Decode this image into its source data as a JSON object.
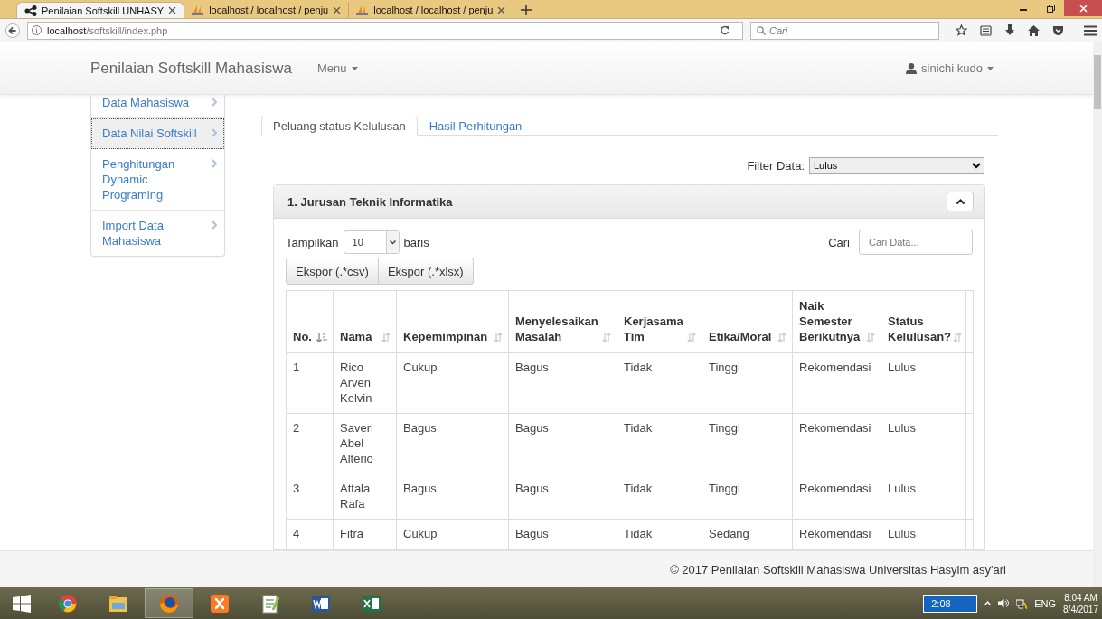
{
  "browser": {
    "tabs": [
      {
        "title": "Penilaian Softskill UNHASY",
        "selected": true,
        "kind": "app"
      },
      {
        "title": "localhost / localhost / penju",
        "selected": false,
        "kind": "pma"
      },
      {
        "title": "localhost / localhost / penju",
        "selected": false,
        "kind": "pma"
      }
    ],
    "url": {
      "host": "localhost",
      "path": "/softskill/index.php"
    },
    "search": {
      "placeholder": "Cari"
    }
  },
  "navbar": {
    "brand": "Penilaian Softskill Mahasiswa",
    "menu": "Menu",
    "user": "sinichi kudo"
  },
  "sidebar": {
    "items": [
      {
        "label": "Data Mahasiswa",
        "selected": false
      },
      {
        "label": "Data Nilai Softskill",
        "selected": true
      },
      {
        "label": "Penghitungan Dynamic Programing",
        "selected": false
      },
      {
        "label": "Import Data Mahasiswa",
        "selected": false
      }
    ]
  },
  "tabs": [
    {
      "label": "Peluang status Kelulusan",
      "selected": true
    },
    {
      "label": "Hasil Perhitungan",
      "selected": false
    }
  ],
  "filter": {
    "label": "Filter Data:",
    "value": "Lulus"
  },
  "panel": {
    "title": "1. Jurusan Teknik Informatika",
    "expanded": true,
    "length": {
      "label": "Tampilkan",
      "value": "10",
      "suffix": "baris"
    },
    "search": {
      "label": "Cari",
      "placeholder": "Cari Data..."
    },
    "buttons": [
      "Ekspor (.*csv)",
      "Ekspor (.*xlsx)"
    ],
    "table": {
      "columns": [
        {
          "label": "No.",
          "sorted": true
        },
        {
          "label": "Nama",
          "sorted": false
        },
        {
          "label": "Kepemimpinan",
          "sorted": false
        },
        {
          "label": "Menyelesaikan Masalah",
          "sorted": false
        },
        {
          "label": "Kerjasama Tim",
          "sorted": false
        },
        {
          "label": "Etika/Moral",
          "sorted": false
        },
        {
          "label": "Naik Semester Berikutnya",
          "sorted": false
        },
        {
          "label": "Status Kelulusan?",
          "sorted": false
        }
      ],
      "rows": [
        [
          "1",
          "Rico Arven Kelvin",
          "Cukup",
          "Bagus",
          "Tidak",
          "Tinggi",
          "Rekomendasi",
          "Lulus"
        ],
        [
          "2",
          "Saveri Abel Alterio",
          "Bagus",
          "Bagus",
          "Tidak",
          "Tinggi",
          "Rekomendasi",
          "Lulus"
        ],
        [
          "3",
          "Attala Rafa",
          "Bagus",
          "Bagus",
          "Tidak",
          "Tinggi",
          "Rekomendasi",
          "Lulus"
        ],
        [
          "4",
          "Fitra",
          "Cukup",
          "Bagus",
          "Tidak",
          "Sedang",
          "Rekomendasi",
          "Lulus"
        ]
      ]
    }
  },
  "footer": "© 2017 Penilaian Softskill Mahasiswa Universitas Hasyim asy'ari",
  "taskbar": {
    "apps": [
      {
        "kind": "chrome",
        "active": false
      },
      {
        "kind": "explorer",
        "active": false
      },
      {
        "kind": "firefox",
        "active": true
      },
      {
        "kind": "xampp",
        "active": false
      },
      {
        "kind": "notepad",
        "active": false
      },
      {
        "kind": "word",
        "active": false
      },
      {
        "kind": "excel",
        "active": false
      }
    ],
    "widget": "2:08",
    "lang": "ENG",
    "time": "8:04 AM",
    "date": "8/4/2017"
  }
}
